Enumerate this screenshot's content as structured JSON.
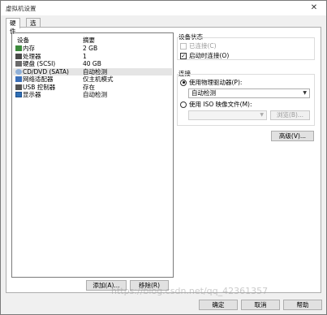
{
  "window": {
    "title": "虚拟机设置"
  },
  "tabs": [
    {
      "label": "硬件"
    },
    {
      "label": "选项"
    }
  ],
  "device_list": {
    "headers": {
      "device": "设备",
      "summary": "摘要"
    },
    "rows": [
      {
        "name": "内存",
        "summary": "2 GB",
        "icon": "memory-icon",
        "icon_color": "#3c8a3c"
      },
      {
        "name": "处理器",
        "summary": "1",
        "icon": "cpu-icon",
        "icon_color": "#4a4a4a"
      },
      {
        "name": "硬盘 (SCSI)",
        "summary": "40 GB",
        "icon": "harddisk-icon",
        "icon_color": "#6b6b6b"
      },
      {
        "name": "CD/DVD (SATA)",
        "summary": "自动检测",
        "icon": "cd-dvd-icon",
        "icon_color": "#8fb0d8",
        "selected": true
      },
      {
        "name": "网络适配器",
        "summary": "仅主机模式",
        "icon": "network-adapter-icon",
        "icon_color": "#3b6fb8"
      },
      {
        "name": "USB 控制器",
        "summary": "存在",
        "icon": "usb-icon",
        "icon_color": "#555555"
      },
      {
        "name": "显示器",
        "summary": "自动检测",
        "icon": "monitor-icon",
        "icon_color": "#2f6fb5"
      }
    ],
    "add_button": "添加(A)...",
    "remove_button": "移除(R)"
  },
  "device_status": {
    "title": "设备状态",
    "connected": {
      "label": "已连接(C)",
      "checked": false,
      "disabled": true
    },
    "connect_on_power": {
      "label": "启动时连接(O)",
      "checked": true
    }
  },
  "connection": {
    "title": "连接",
    "use_physical": {
      "label": "使用物理驱动器(P):",
      "selected": true
    },
    "physical_select": "自动检测",
    "use_iso": {
      "label": "使用 ISO 映像文件(M):",
      "selected": false
    },
    "iso_value": "",
    "browse_button": "浏览(B)..."
  },
  "advanced_button": "高级(V)...",
  "footer": {
    "ok": "确定",
    "cancel": "取消",
    "help": "帮助"
  },
  "watermark": "https://blog.csdn.net/qq_42361357"
}
